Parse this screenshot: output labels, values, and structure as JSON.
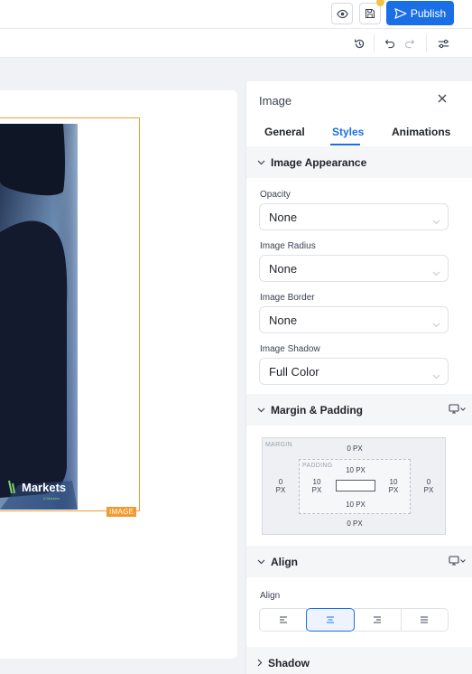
{
  "topbar": {
    "publish_label": "Publish"
  },
  "panel": {
    "title": "Image",
    "tabs": [
      {
        "label": "General",
        "active": false
      },
      {
        "label": "Styles",
        "active": true
      },
      {
        "label": "Animations",
        "active": false
      }
    ],
    "image_appearance": {
      "header": "Image Appearance",
      "fields": [
        {
          "label": "Opacity",
          "value": "None"
        },
        {
          "label": "Image Radius",
          "value": "None"
        },
        {
          "label": "Image Border",
          "value": "None"
        },
        {
          "label": "Image Shadow",
          "value": "Full Color"
        }
      ]
    },
    "margin_padding": {
      "header": "Margin & Padding",
      "margin_label": "MARGIN",
      "padding_label": "PADDING",
      "margin": {
        "top": "0 PX",
        "left_num": "0",
        "left_unit": "PX",
        "right_num": "0",
        "right_unit": "PX",
        "bottom": "0 PX"
      },
      "padding": {
        "top": "10 PX",
        "left_num": "10",
        "left_unit": "PX",
        "right_num": "10",
        "right_unit": "PX",
        "bottom": "10 PX"
      }
    },
    "align": {
      "header": "Align",
      "label": "Align",
      "selected_index": 1
    },
    "shadow": {
      "header": "Shadow"
    }
  },
  "canvas": {
    "element_tag": "IMAGE",
    "logo_text": "Markets",
    "logo_subtext": "ICMarkets"
  },
  "colors": {
    "accent": "#1a6fe6",
    "selection": "#f29a2e"
  }
}
